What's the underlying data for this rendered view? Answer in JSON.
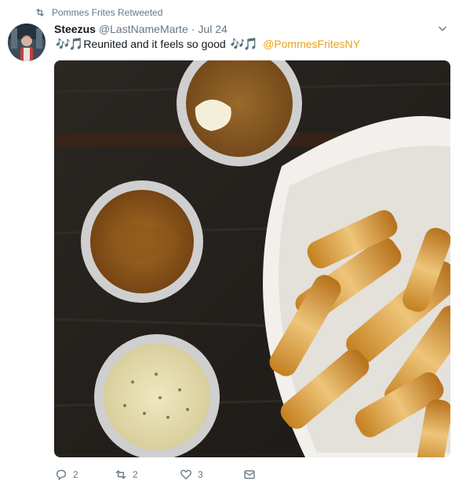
{
  "retweet_banner": {
    "text": "Pommes Frites Retweeted",
    "icon": "retweet-icon"
  },
  "tweet": {
    "author_name": "Steezus",
    "author_handle": "@LastNameMarte",
    "separator": "·",
    "timestamp": "Jul 24",
    "text_emoji_left": "🎶🎵",
    "text_main": "Reunited and it feels so good",
    "text_emoji_right": "🎶🎵",
    "mention": "@PommesFritesNY",
    "mention_color": "#e8a21a",
    "link_color": "#1da1f2"
  },
  "actions": {
    "reply_count": "2",
    "retweet_count": "2",
    "like_count": "3",
    "reply_icon": "reply-icon",
    "retweet_icon": "retweet-icon",
    "like_icon": "heart-icon",
    "message_icon": "envelope-icon"
  }
}
